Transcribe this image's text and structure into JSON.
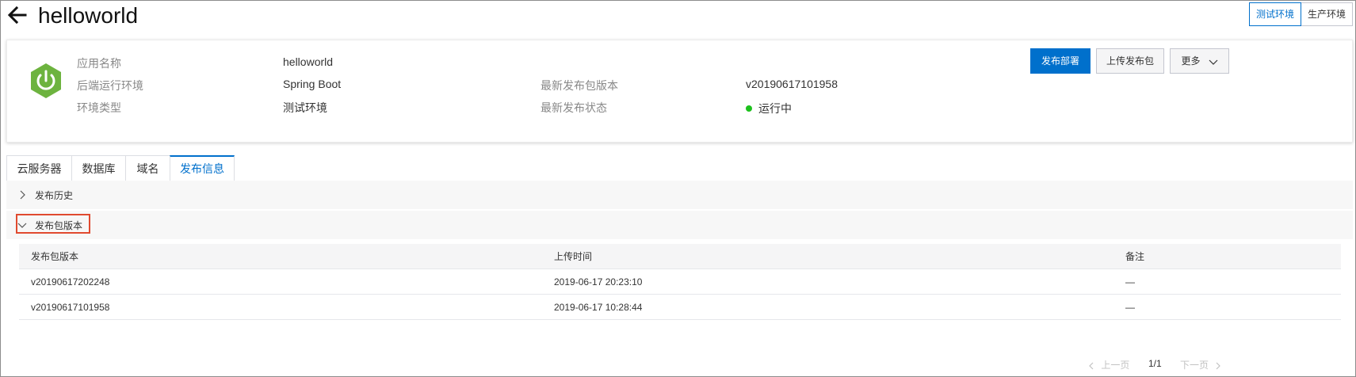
{
  "header": {
    "title": "helloworld",
    "env_options": [
      {
        "label": "测试环境",
        "active": true
      },
      {
        "label": "生产环境",
        "active": false
      }
    ]
  },
  "info": {
    "icon": "spring-power-icon",
    "fields_left": [
      {
        "label": "应用名称",
        "value": "helloworld"
      },
      {
        "label": "后端运行环境",
        "value": "Spring Boot"
      },
      {
        "label": "环境类型",
        "value": "测试环境"
      }
    ],
    "fields_right": [
      {
        "label": "最新发布包版本",
        "value": "v20190617101958"
      },
      {
        "label": "最新发布状态",
        "value": "运行中"
      }
    ],
    "status_color": "#1dc11d",
    "actions": {
      "deploy": "发布部署",
      "upload": "上传发布包",
      "more": "更多"
    }
  },
  "tabs": [
    {
      "label": "云服务器",
      "active": false
    },
    {
      "label": "数据库",
      "active": false
    },
    {
      "label": "域名",
      "active": false
    },
    {
      "label": "发布信息",
      "active": true
    }
  ],
  "sections": {
    "history": {
      "title": "发布历史",
      "expanded": false
    },
    "packages": {
      "title": "发布包版本",
      "expanded": true
    }
  },
  "table": {
    "columns": [
      "发布包版本",
      "上传时间",
      "备注"
    ],
    "rows": [
      [
        "v20190617202248",
        "2019-06-17 20:23:10",
        "—"
      ],
      [
        "v20190617101958",
        "2019-06-17 10:28:44",
        "—"
      ]
    ]
  },
  "pagination": {
    "prev": "上一页",
    "page": "1/1",
    "next": "下一页"
  },
  "colors": {
    "accent": "#0070cc",
    "highlight": "#e04a2f",
    "brand_green": "#6db33f"
  }
}
